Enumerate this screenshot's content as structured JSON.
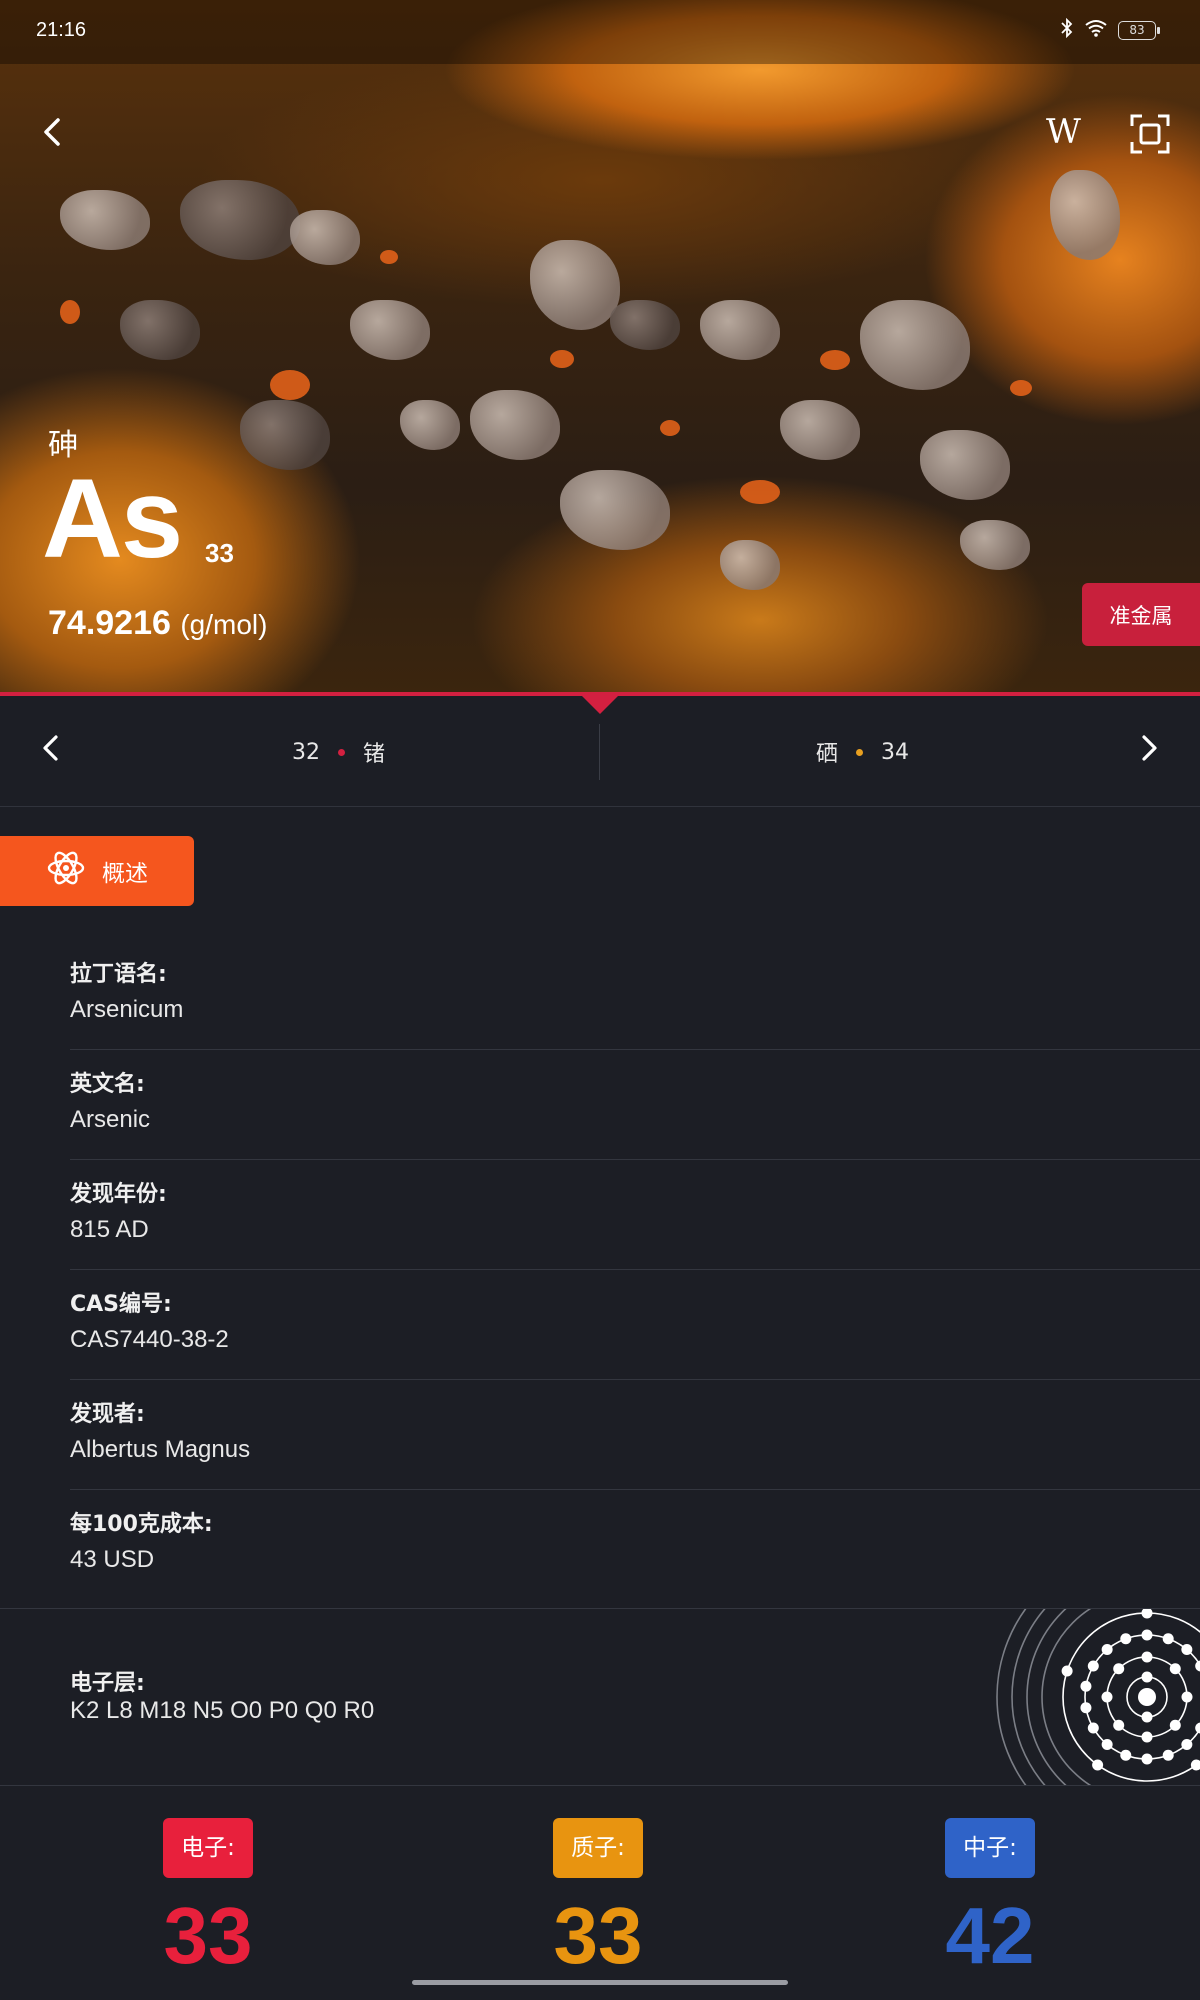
{
  "status_bar": {
    "time": "21:16",
    "battery": "83"
  },
  "hero": {
    "name_cn": "砷",
    "symbol": "As",
    "atomic_number": "33",
    "atomic_mass": "74.9216",
    "mass_unit": "(g/mol)",
    "category": "准金属",
    "category_color": "#c8203c",
    "wiki_label": "W"
  },
  "nav": {
    "prev": {
      "number": "32",
      "name": "锗",
      "dot_color": "#d32040"
    },
    "next": {
      "name": "硒",
      "number": "34",
      "dot_color": "#e8a020"
    }
  },
  "tab": {
    "label": "概述",
    "color": "#f5561e"
  },
  "properties": [
    {
      "label": "拉丁语名:",
      "value": "Arsenicum"
    },
    {
      "label": "英文名:",
      "value": "Arsenic"
    },
    {
      "label": "发现年份:",
      "value": "815 AD"
    },
    {
      "label": "CAS编号:",
      "value": "CAS7440-38-2"
    },
    {
      "label": "发现者:",
      "value": "Albertus Magnus"
    },
    {
      "label": "每100克成本:",
      "value": "43 USD"
    }
  ],
  "electron_shells": {
    "label": "电子层:",
    "value": "K2 L8 M18 N5 O0 P0 Q0 R0"
  },
  "particles": {
    "electrons": {
      "label": "电子:",
      "value": "33",
      "color": "#e8203c"
    },
    "protons": {
      "label": "质子:",
      "value": "33",
      "color": "#e89410"
    },
    "neutrons": {
      "label": "中子:",
      "value": "42",
      "color": "#2f63c8"
    }
  }
}
